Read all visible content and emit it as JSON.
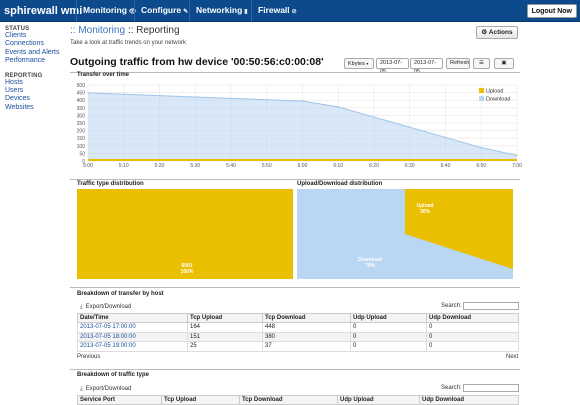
{
  "topbar": {
    "brand": "sphirewall wmi",
    "nav": [
      {
        "label": "Monitoring",
        "icon": "eye-icon",
        "glyph": "👁"
      },
      {
        "label": "Configure",
        "icon": "wrench-icon",
        "glyph": "✎"
      },
      {
        "label": "Networking",
        "icon": "signal-icon",
        "glyph": "▮"
      },
      {
        "label": "Firewall",
        "icon": "ban-icon",
        "glyph": "⊘"
      }
    ],
    "logout": "Logout Now"
  },
  "sidebar": {
    "status_heading": "STATUS",
    "status_items": [
      "Clients",
      "Connections",
      "Events and Alerts",
      "Performance"
    ],
    "reporting_heading": "REPORTING",
    "reporting_items": [
      "Hosts",
      "Users",
      "Devices",
      "Websites"
    ]
  },
  "header": {
    "crumb_section": ":: Monitoring",
    "crumb_page": ":: Reporting",
    "subtitle": "Take a look at traffic trends on your network",
    "actions_label": "Actions",
    "title": "Outgoing traffic from hw device '00:50:56:c0:00:08'"
  },
  "controls": {
    "unit": "Kbytes",
    "date_from": "2013-07-05",
    "date_to": "2013-07-05",
    "refresh": "Refresh"
  },
  "sections": {
    "transfer": "Transfer over time",
    "type_dist": "Traffic type distribution",
    "updown_dist": "Upload/Download distribution",
    "breakdown_host": "Breakdown of transfer by host",
    "breakdown_type": "Breakdown of traffic type"
  },
  "chart_data": [
    {
      "type": "area",
      "x": [
        "5:00",
        "5:10",
        "5:20",
        "5:30",
        "5:40",
        "5:50",
        "6:00",
        "6:10",
        "6:20",
        "6:30",
        "6:40",
        "6:50",
        "7:00"
      ],
      "series": [
        {
          "name": "Upload",
          "color": "#e9bf00",
          "values": [
            0,
            0,
            0,
            0,
            0,
            0,
            0,
            0,
            0,
            0,
            0,
            0,
            0
          ]
        },
        {
          "name": "Download",
          "color": "#b9d6f2",
          "values": [
            448,
            439,
            430,
            421,
            412,
            403,
            394,
            356,
            289,
            222,
            155,
            88,
            37
          ]
        }
      ],
      "yticks": [
        0,
        50,
        100,
        150,
        200,
        250,
        300,
        350,
        400,
        450,
        500
      ],
      "ylim": [
        0,
        500
      ],
      "legend": "top-right"
    },
    {
      "type": "pie",
      "labels": [
        "tcp"
      ],
      "values": [
        100
      ],
      "slice_labels": [
        "6001\n100%"
      ],
      "colors": [
        "#e9bf00"
      ]
    },
    {
      "type": "pie",
      "labels": [
        "Upload",
        "Download"
      ],
      "values": [
        30,
        70
      ],
      "slice_labels": [
        "Upload\n30%",
        "Download\n70%"
      ],
      "colors": [
        "#e9bf00",
        "#b9d6f2"
      ]
    }
  ],
  "host_table": {
    "export": "Export/Download",
    "search_label": "Search:",
    "columns": [
      "Date/Time",
      "Tcp Upload",
      "Tcp Download",
      "Udp Upload",
      "Udp Download"
    ],
    "rows": [
      [
        "2013-07-05 17:00:00",
        "164",
        "448",
        "0",
        "0"
      ],
      [
        "2013-07-05 18:00:00",
        "151",
        "380",
        "0",
        "0"
      ],
      [
        "2013-07-05 19:00:00",
        "25",
        "37",
        "0",
        "0"
      ]
    ],
    "previous": "Previous",
    "next": "Next"
  },
  "type_table": {
    "export": "Export/Download",
    "search_label": "Search:",
    "columns": [
      "Service Port",
      "Tcp Upload",
      "Tcp Download",
      "Udp Upload",
      "Udp Download"
    ]
  }
}
